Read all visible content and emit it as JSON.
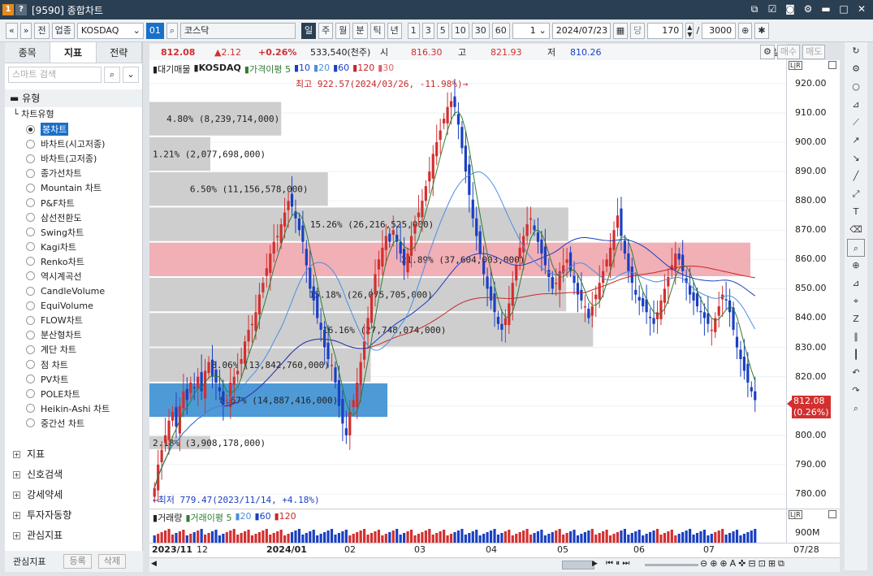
{
  "window": {
    "badges": [
      "1",
      "?"
    ],
    "title": "[9590] 종합차트"
  },
  "toolbar": {
    "nav_prev": "«",
    "nav_dd": "»",
    "btn_jeon": "전",
    "btn_industry": "업종",
    "market_select": "KOSDAQ",
    "code_badge": "01",
    "search_glyph": "⌕",
    "name_field": "코스닥",
    "periods": [
      "일",
      "주",
      "월",
      "분",
      "틱",
      "년"
    ],
    "intervals": [
      "1",
      "3",
      "5",
      "10",
      "30",
      "60"
    ],
    "count_select": "1",
    "date": "2024/07/23",
    "dang": "당",
    "span_value": "170",
    "slash": "/",
    "total": "3000"
  },
  "left_panel": {
    "tabs": [
      "종목",
      "지표",
      "전략"
    ],
    "search_placeholder": "스마트 검색",
    "section_type": "유형",
    "tree_root": "차트유형",
    "chart_types": [
      "봉차트",
      "바차트(시고저종)",
      "바차트(고저종)",
      "종가선차트",
      "Mountain 차트",
      "P&F차트",
      "삼선전환도",
      "Swing차트",
      "Kagi차트",
      "Renko차트",
      "역시계곡선",
      "CandleVolume",
      "EquiVolume",
      "FLOW차트",
      "분산형차트",
      "계단 차트",
      "점 차트",
      "PV차트",
      "POLE차트",
      "Heikin-Ashi 차트",
      "중간선 차트"
    ],
    "selected_type": "봉차트",
    "bottom_sections": [
      "지표",
      "신호검색",
      "강세약세",
      "투자자동향",
      "관심지표"
    ],
    "fav_label": "관심지표",
    "fav_register": "등록",
    "fav_delete": "삭제"
  },
  "infobar": {
    "price": "812.08",
    "change": "▲2.12",
    "change_pct": "+0.26%",
    "volume": "533,540(천주)",
    "open_label": "시",
    "open": "816.30",
    "high_label": "고",
    "high": "821.93",
    "low_label": "저",
    "low": "810.26",
    "period_tag": "[일]",
    "buy": "매수",
    "sell": "매도"
  },
  "legend": {
    "main": "대기매물",
    "name": "KOSDAQ",
    "ma_label": "가격이평 5",
    "ma": [
      "10",
      "20",
      "60",
      "120",
      "30"
    ],
    "colors": {
      "ma5": "#2e7d32",
      "ma10": "#1a3fc2",
      "ma20": "#4a8fe0",
      "ma60": "#1a3fc2",
      "ma120": "#c62828",
      "ma30": "#e0626a"
    }
  },
  "annotations": {
    "highest": "최고 922.57(2024/03/26, -11.98%)→",
    "lowest": "←최저 779.47(2023/11/14, +4.18%)"
  },
  "volume_legend": {
    "main": "거래량",
    "ma_label": "거래이평 5",
    "ma": [
      "20",
      "60",
      "120"
    ],
    "axis_label": "900M"
  },
  "current_price_tag": {
    "price": "812.08",
    "pct": "(0.26%)"
  },
  "chart_data": {
    "type": "candlestick",
    "symbol": "KOSDAQ",
    "period": "daily",
    "x_labels": [
      "2023/11",
      "12",
      "2024/01",
      "02",
      "03",
      "04",
      "05",
      "06",
      "07",
      "07/28"
    ],
    "ylim": [
      775,
      928
    ],
    "y_ticks": [
      780,
      790,
      800,
      810,
      820,
      830,
      840,
      850,
      860,
      870,
      880,
      890,
      900,
      910,
      920
    ],
    "highest": {
      "value": 922.57,
      "date": "2024/03/26",
      "pct": -11.98
    },
    "lowest": {
      "value": 779.47,
      "date": "2023/11/14",
      "pct": 4.18
    },
    "close_series": [
      782,
      790,
      795,
      800,
      805,
      808,
      803,
      810,
      815,
      812,
      818,
      816,
      820,
      815,
      822,
      825,
      820,
      818,
      815,
      810,
      812,
      818,
      820,
      822,
      826,
      832,
      836,
      838,
      842,
      848,
      852,
      857,
      862,
      866,
      868,
      872,
      876,
      880,
      878,
      874,
      870,
      866,
      858,
      850,
      846,
      840,
      836,
      830,
      826,
      824,
      818,
      810,
      804,
      800,
      808,
      812,
      818,
      825,
      832,
      840,
      848,
      855,
      860,
      864,
      868,
      866,
      870,
      866,
      862,
      858,
      862,
      868,
      872,
      876,
      880,
      885,
      890,
      896,
      900,
      904,
      908,
      912,
      914,
      912,
      906,
      898,
      890,
      882,
      874,
      868,
      862,
      855,
      850,
      846,
      842,
      838,
      836,
      840,
      845,
      852,
      858,
      864,
      868,
      872,
      874,
      870,
      866,
      862,
      858,
      854,
      850,
      852,
      856,
      858,
      860,
      856,
      852,
      848,
      846,
      844,
      840,
      844,
      848,
      852,
      856,
      860,
      864,
      870,
      875,
      868,
      862,
      856,
      852,
      848,
      846,
      844,
      842,
      840,
      838,
      842,
      846,
      850,
      854,
      858,
      862,
      860,
      856,
      852,
      848,
      846,
      844,
      842,
      840,
      838,
      836,
      840,
      844,
      848,
      846,
      842,
      836,
      830,
      826,
      822,
      818,
      815,
      812
    ],
    "supply_zones": [
      {
        "label": "2.18% (3,908,178,000)",
        "low": 795,
        "high": 800,
        "pct": 2.18
      },
      {
        "label": "8.67% (14,887,416,000)",
        "low": 806,
        "high": 818,
        "pct": 8.67,
        "current": true
      },
      {
        "label": "8.06% (13,842,760,000)",
        "low": 818,
        "high": 830,
        "pct": 8.06
      },
      {
        "label": "16.16% (27,748,074,000)",
        "low": 830,
        "high": 842,
        "pct": 16.16
      },
      {
        "label": "15.18% (26,075,705,000)",
        "low": 842,
        "high": 854,
        "pct": 15.18
      },
      {
        "label": "21.89% (37,604,003,000)",
        "low": 854,
        "high": 866,
        "pct": 21.89
      },
      {
        "label": "15.26% (26,216,525,000)",
        "low": 866,
        "high": 878,
        "pct": 15.26
      },
      {
        "label": "6.50% (11,156,578,000)",
        "low": 878,
        "high": 890,
        "pct": 6.5
      },
      {
        "label": "1.21% (2,077,698,000)",
        "low": 890,
        "high": 902,
        "pct": 1.21
      },
      {
        "label": "4.80% (8,239,714,000)",
        "low": 902,
        "high": 914,
        "pct": 4.8
      }
    ]
  }
}
